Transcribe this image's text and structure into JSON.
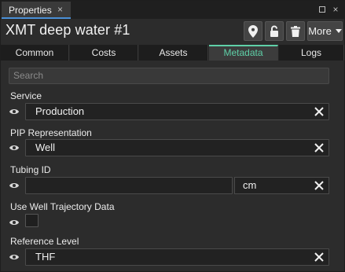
{
  "window": {
    "tab_label": "Properties",
    "close_glyph": "×",
    "minimize_glyph": "—"
  },
  "header": {
    "title": "XMT deep water #1",
    "more_label": "More"
  },
  "tabs": [
    {
      "label": "Common",
      "active": false
    },
    {
      "label": "Costs",
      "active": false
    },
    {
      "label": "Assets",
      "active": false
    },
    {
      "label": "Metadata",
      "active": true
    },
    {
      "label": "Logs",
      "active": false
    }
  ],
  "search": {
    "placeholder": "Search"
  },
  "fields": {
    "service": {
      "label": "Service",
      "value": "Production"
    },
    "pip_representation": {
      "label": "PIP Representation",
      "value": "Well"
    },
    "tubing_id": {
      "label": "Tubing ID",
      "value": "",
      "unit": "cm"
    },
    "use_well_trajectory": {
      "label": "Use Well Trajectory Data",
      "checked": false
    },
    "reference_level": {
      "label": "Reference Level",
      "value": "THF"
    }
  },
  "icons": {
    "location": "location-pin-icon",
    "lock": "unlock-icon",
    "delete": "trash-icon",
    "eye": "eye-icon",
    "clear": "close-icon"
  },
  "colors": {
    "accent_active_tab": "#5fd0a8",
    "window_tab_underline": "#4a8fd6"
  }
}
